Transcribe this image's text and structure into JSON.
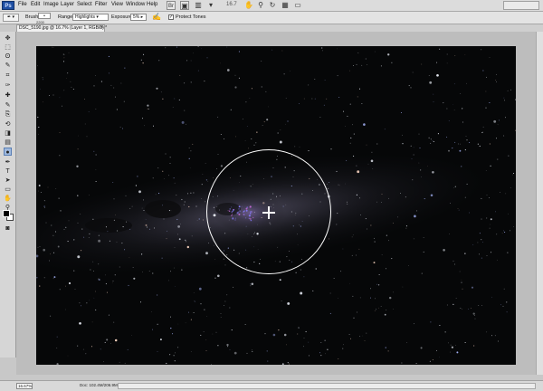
{
  "app": {
    "logo_text": "Ps"
  },
  "menu": {
    "items": [
      "File",
      "Edit",
      "Image",
      "Layer",
      "Select",
      "Filter",
      "View",
      "Window",
      "Help"
    ]
  },
  "toolbar_right": {
    "zoom_level": "16.7",
    "icons": [
      "bridge-icon",
      "mini-bridge-icon",
      "hand-tool-icon",
      "zoom-tool-icon",
      "rotate-view-icon",
      "arrange-documents-icon",
      "screen-mode-icon"
    ],
    "workspace_label": ""
  },
  "options": {
    "brush_label": "Brush:",
    "brush_size": "2200",
    "range_label": "Range:",
    "range_value": "Highlights",
    "exposure_label": "Exposure:",
    "exposure_value": "5%",
    "protect_tones_label": "Protect Tones",
    "protect_tones_checked": "✓"
  },
  "document": {
    "tab_title": "DSC_5190.jpg @ 16.7% (Layer 1, RGB/8) *",
    "close_glyph": "×"
  },
  "tools": [
    "move-tool-icon",
    "marquee-tool-icon",
    "lasso-tool-icon",
    "quick-select-tool-icon",
    "crop-tool-icon",
    "eyedropper-tool-icon",
    "healing-brush-tool-icon",
    "brush-tool-icon",
    "clone-stamp-tool-icon",
    "history-brush-tool-icon",
    "eraser-tool-icon",
    "gradient-tool-icon",
    "dodge-burn-tool-icon",
    "pen-tool-icon",
    "type-tool-icon",
    "path-select-tool-icon",
    "shape-tool-icon",
    "hand-tool-icon",
    "zoom-tool-icon"
  ],
  "active_tool": "dodge-burn-tool-icon",
  "status": {
    "zoom_field": "16.67%",
    "doc_info": "Doc: 102.4M/206.9M"
  },
  "colors": {
    "foreground": "#000000",
    "background": "#ffffff",
    "canvas_bg": "#050607"
  }
}
